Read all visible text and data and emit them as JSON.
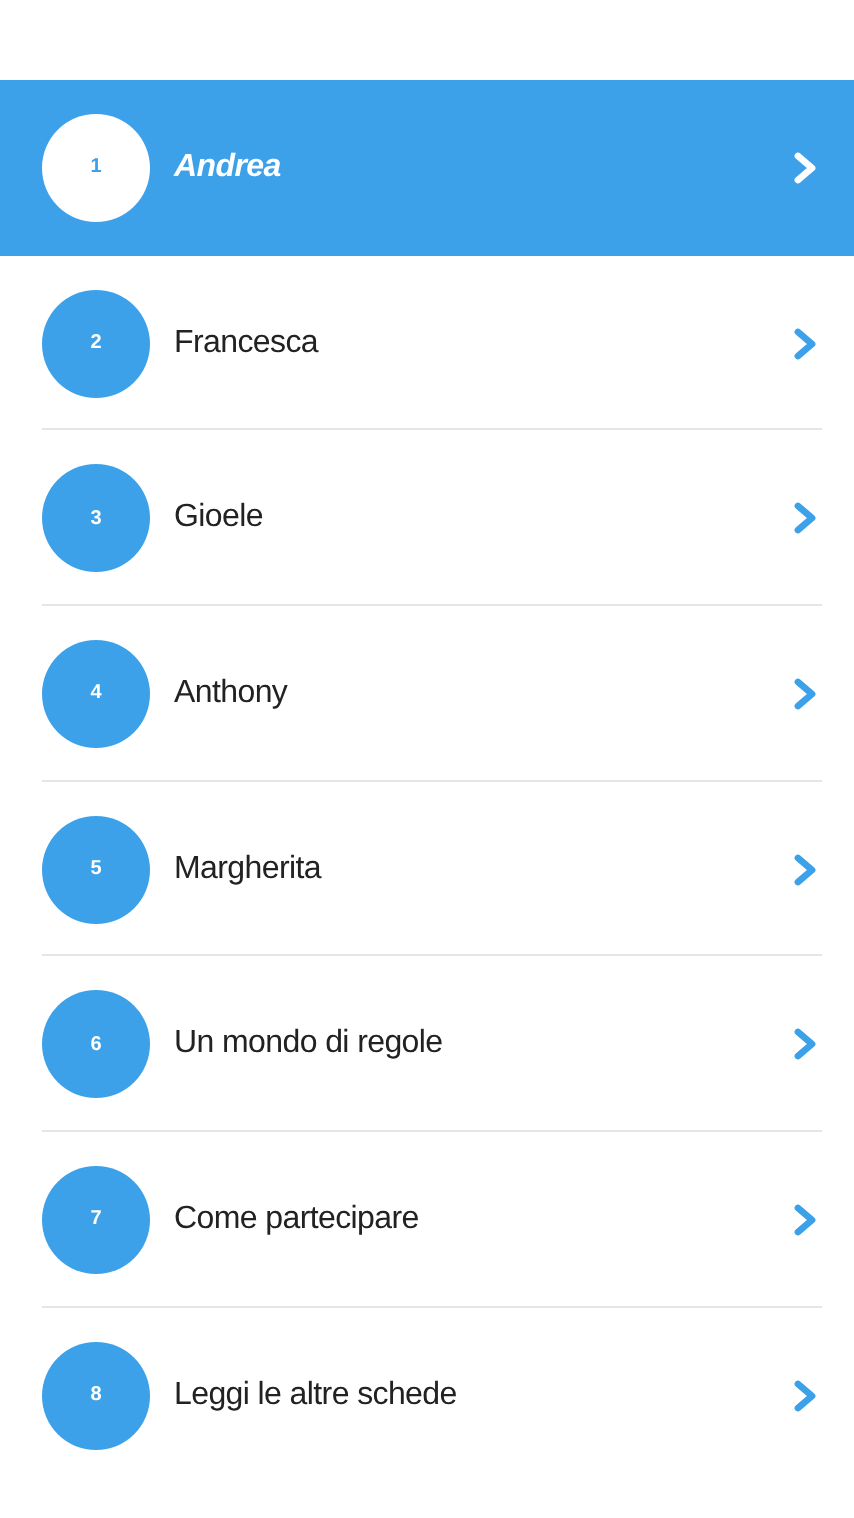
{
  "items": [
    {
      "number": "1",
      "label": "Andrea",
      "selected": true
    },
    {
      "number": "2",
      "label": "Francesca",
      "selected": false
    },
    {
      "number": "3",
      "label": "Gioele",
      "selected": false
    },
    {
      "number": "4",
      "label": "Anthony",
      "selected": false
    },
    {
      "number": "5",
      "label": "Margherita",
      "selected": false
    },
    {
      "number": "6",
      "label": "Un mondo di regole",
      "selected": false
    },
    {
      "number": "7",
      "label": "Come partecipare",
      "selected": false
    },
    {
      "number": "8",
      "label": "Leggi le altre schede",
      "selected": false
    }
  ]
}
